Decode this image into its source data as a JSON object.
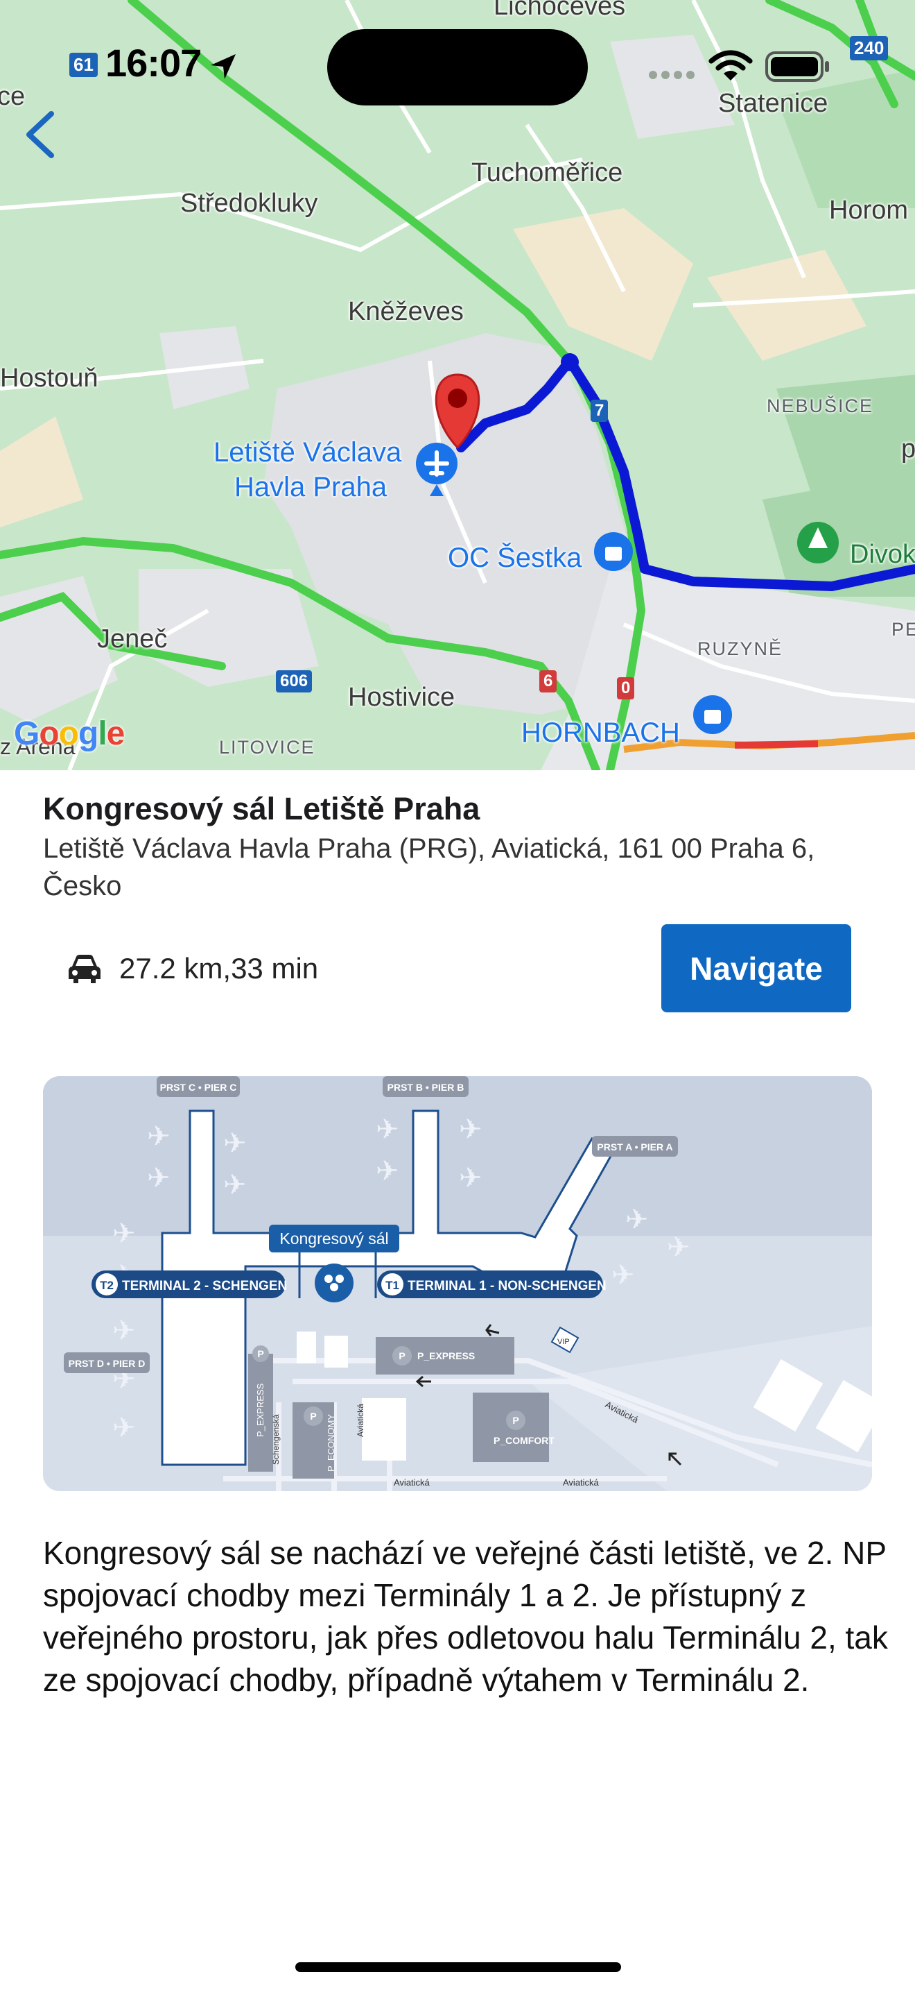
{
  "status_bar": {
    "badge_left": "61",
    "time": "16:07",
    "badge_right": "240"
  },
  "map": {
    "labels": {
      "lichoceves": "Lichoceves",
      "statenice": "Statenice",
      "tuchomerice": "Tuchoměřice",
      "stredokluky": "Středokluky",
      "horom": "Horom",
      "knezeves": "Kněževes",
      "hostoun": "Hostouň",
      "nebusice": "NEBUŠICE",
      "p_edge": "p",
      "airport_line1": "Letiště Václava",
      "airport_line2": "Havla Praha",
      "oc_sestka": "OC Šestka",
      "divok": "Divok",
      "pe": "PE",
      "jenec": "Jeneč",
      "ruzyne": "RUZYNĚ",
      "hostivice": "Hostivice",
      "litovice": "LITOVICE",
      "hornbach": "HORNBACH",
      "z_arena": "z Arena",
      "ce": "ce"
    },
    "road_shields": {
      "r7": "7",
      "r606": "606",
      "r6": "6",
      "r0": "0"
    },
    "google": "Google"
  },
  "place": {
    "title": "Kongresový sál Letiště Praha",
    "address": "Letiště Václava Havla Praha (PRG), Aviatická, 161 00 Praha 6, Česko",
    "route_summary": "27.2 km,33 min",
    "navigate_label": "Navigate"
  },
  "floorplan": {
    "piers": {
      "c": "PRST C • PIER C",
      "b": "PRST B • PIER B",
      "a": "PRST A • PIER A",
      "d": "PRST D • PIER D"
    },
    "callout": "Kongresový sál",
    "t2": "T2",
    "t2_label": "TERMINAL 2 - SCHENGEN",
    "t1": "T1",
    "t1_label": "TERMINAL 1 - NON-SCHENGEN",
    "p": "P",
    "p_express": "P_EXPRESS",
    "p_economy": "P_ECONOMY",
    "p_comfort": "P_COMFORT",
    "vip": "VIP",
    "schengenska": "Schengenská",
    "aviaticka": "Aviatická"
  },
  "description": "Kongresový sál se nachází ve veřejné části letiště, ve 2. NP spojovací chodby mezi Terminály 1 a 2. Je přístupný z veřejného prostoru, jak přes odletovou halu Terminálu 2, tak ze spojovací chodby, případně výtahem v Terminálu 2.",
  "colors": {
    "route": "#0b19d4",
    "accent": "#0f68c1",
    "pin": "#e53935",
    "traffic_green": "#3ccd3c"
  }
}
